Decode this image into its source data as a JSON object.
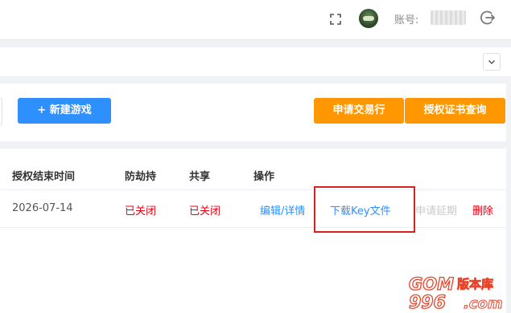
{
  "header": {
    "account_label": "账号:",
    "icons": [
      "fullscreen-icon",
      "avatar",
      "logout-icon"
    ]
  },
  "toolbar": {
    "new_game_label": "+ 新建游戏",
    "apply_label": "申请交易行",
    "query_label": "授权证书查询"
  },
  "table": {
    "columns": [
      "授权结束时间",
      "防劫持",
      "共享",
      "操作"
    ],
    "rows": [
      {
        "end_date": "2026-07-14",
        "anti_hijack": "已关闭",
        "share": "已关闭",
        "actions": {
          "edit": "编辑/详情",
          "download_key": "下载Key文件",
          "extend": "申请延期",
          "delete": "删除"
        }
      }
    ]
  },
  "watermark": {
    "brand": "GOM",
    "number": "996",
    "suffix": "版本库",
    "domain": ".com"
  },
  "colors": {
    "primary": "#2e8fff",
    "warning": "#ff9800",
    "danger": "#e60012",
    "highlight_border": "#d9201c"
  }
}
